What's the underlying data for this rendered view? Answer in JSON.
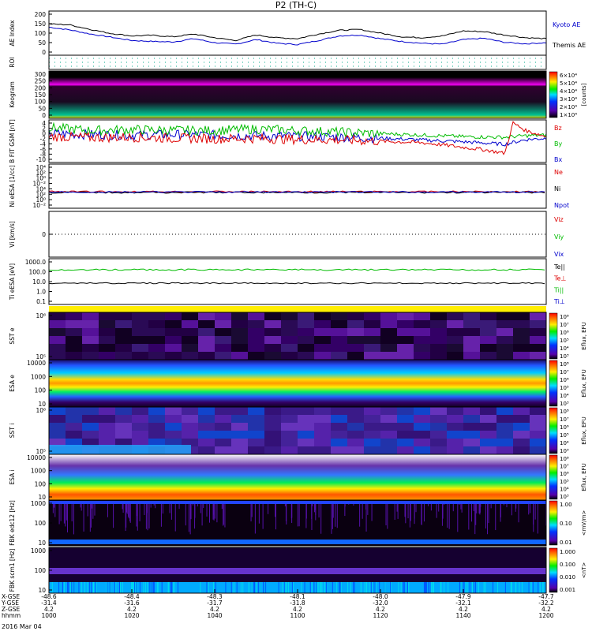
{
  "title": "P2 (TH-C)",
  "date": "2016 Mar 04",
  "chart_data": [
    {
      "type": "line",
      "panel": "ae",
      "ylabel": "AE Index",
      "yticks": [
        "200",
        "150",
        "100",
        "50",
        "0"
      ],
      "ylim": [
        -20,
        220
      ],
      "series": [
        {
          "name": "Kyoto AE",
          "color": "#0000cc",
          "t": [
            1000,
            1005,
            1010,
            1015,
            1020,
            1025,
            1030,
            1035,
            1040,
            1045,
            1050,
            1055,
            1100,
            1105,
            1110,
            1115,
            1120,
            1125,
            1130,
            1135,
            1140,
            1145,
            1150,
            1155,
            1200
          ],
          "values": [
            132,
            118,
            95,
            78,
            60,
            55,
            52,
            70,
            48,
            40,
            65,
            45,
            38,
            60,
            85,
            90,
            70,
            55,
            45,
            40,
            65,
            72,
            50,
            42,
            48
          ]
        },
        {
          "name": "Themis AE",
          "color": "#000000",
          "t": [
            1000,
            1005,
            1010,
            1015,
            1020,
            1025,
            1030,
            1035,
            1040,
            1045,
            1050,
            1055,
            1100,
            1105,
            1110,
            1115,
            1120,
            1125,
            1130,
            1135,
            1140,
            1145,
            1150,
            1155,
            1200
          ],
          "values": [
            150,
            145,
            120,
            98,
            85,
            88,
            80,
            95,
            75,
            60,
            90,
            75,
            70,
            95,
            115,
            120,
            100,
            80,
            75,
            85,
            112,
            108,
            90,
            75,
            70
          ]
        }
      ]
    },
    {
      "type": "heatmap",
      "panel": "roi",
      "ylabel": "ROI"
    },
    {
      "type": "heatmap",
      "panel": "keogram",
      "ylabel": "Keogram",
      "yticks": [
        "300",
        "250",
        "200",
        "150",
        "100",
        "50",
        "0"
      ],
      "ylim": [
        0,
        300
      ],
      "colorbar": {
        "label": "[counts]",
        "ticks": [
          "6×10⁴",
          "5×10⁴",
          "4×10⁴",
          "3×10⁴",
          "2×10⁴",
          "1×10⁴"
        ]
      }
    },
    {
      "type": "line",
      "panel": "bfield",
      "ylabel": "B FIT GSM [nT]",
      "yticks": [
        "4",
        "2",
        "0",
        "-2",
        "-4",
        "-6",
        "-8",
        "-10"
      ],
      "ylim": [
        -10,
        4
      ],
      "series": [
        {
          "name": "Bz",
          "color": "#dd0000",
          "t": [
            1000,
            1010,
            1020,
            1030,
            1040,
            1050,
            1100,
            1110,
            1120,
            1130,
            1135,
            1140,
            1145,
            1150,
            1152,
            1155,
            1200
          ],
          "values": [
            -1.5,
            -1.8,
            -1.7,
            -2.0,
            -2.2,
            -2.1,
            -2.4,
            -2.6,
            -3.0,
            -3.5,
            -4.2,
            -5.0,
            -5.8,
            -7.0,
            3.0,
            0.5,
            -1.5
          ]
        },
        {
          "name": "By",
          "color": "#00bb00",
          "t": [
            1000,
            1010,
            1020,
            1030,
            1040,
            1050,
            1100,
            1110,
            1120,
            1130,
            1140,
            1150,
            1155,
            1200
          ],
          "values": [
            1.5,
            0.5,
            0.8,
            0.6,
            0.5,
            1.0,
            0.5,
            0.0,
            -0.5,
            -1.0,
            -1.5,
            -1.7,
            -1.2,
            -1.0
          ]
        },
        {
          "name": "Bx",
          "color": "#0000cc",
          "t": [
            1000,
            1010,
            1020,
            1030,
            1040,
            1050,
            1100,
            1110,
            1120,
            1130,
            1140,
            1150,
            1155,
            1200
          ],
          "values": [
            -0.5,
            -0.8,
            -1.0,
            -0.8,
            -1.0,
            -1.2,
            -1.4,
            -1.6,
            -2.0,
            -2.6,
            -3.2,
            -4.0,
            -2.5,
            -2.0
          ]
        }
      ]
    },
    {
      "type": "line",
      "panel": "density",
      "ylabel": "Ni eESA [1/cc]",
      "yticks": [
        "10⁴",
        "10²",
        "10⁰",
        "10⁻²",
        "10⁴",
        "10²",
        "10⁰",
        "10⁻²"
      ],
      "series": [
        {
          "name": "Ne",
          "color": "#dd0000"
        },
        {
          "name": "Ni",
          "color": "#000000"
        },
        {
          "name": "Npot",
          "color": "#0000cc"
        }
      ]
    },
    {
      "type": "line",
      "panel": "velocity",
      "ylabel": "Vi [km/s]",
      "yticks": [
        "0"
      ],
      "series": [
        {
          "name": "Viz",
          "color": "#dd0000"
        },
        {
          "name": "Viy",
          "color": "#00bb00"
        },
        {
          "name": "Vix",
          "color": "#0000cc"
        }
      ]
    },
    {
      "type": "line",
      "panel": "temperature",
      "ylabel": "Ti eESA [eV]",
      "yticks": [
        "1000.0",
        "100.0",
        "10.0",
        "1.0",
        "0.1"
      ],
      "series": [
        {
          "name": "Te||",
          "color": "#000000"
        },
        {
          "name": "Te⊥",
          "color": "#dd0000"
        },
        {
          "name": "Ti||",
          "color": "#00bb00",
          "values": [
            400,
            420,
            390,
            410,
            400,
            430,
            410,
            400
          ]
        },
        {
          "name": "Ti⊥",
          "color": "#0000cc",
          "values": [
            10,
            10,
            11,
            10,
            10,
            11,
            10,
            10
          ]
        }
      ]
    },
    {
      "type": "heatmap",
      "panel": "sst_e",
      "ylabel": "SST e",
      "yticks": [
        "10⁶",
        "10⁵"
      ],
      "colorbar": {
        "label": "Eflux, EFU",
        "ticks": [
          "10⁸",
          "10⁷",
          "10⁶",
          "10⁵",
          "10⁴",
          "10³"
        ]
      }
    },
    {
      "type": "heatmap",
      "panel": "esa_e",
      "ylabel": "ESA e",
      "yticks": [
        "10000",
        "1000",
        "100",
        "10"
      ],
      "colorbar": {
        "label": "Eflux, EFU",
        "ticks": [
          "10⁸",
          "10⁷",
          "10⁶",
          "10⁵",
          "10⁴",
          "10³"
        ]
      }
    },
    {
      "type": "heatmap",
      "panel": "sst_i",
      "ylabel": "SST i",
      "yticks": [
        "10⁶",
        "10⁵"
      ],
      "colorbar": {
        "label": "Eflux, EFU",
        "ticks": [
          "10⁸",
          "10⁷",
          "10⁶",
          "10⁵",
          "10⁴",
          "10³"
        ]
      }
    },
    {
      "type": "heatmap",
      "panel": "esa_i",
      "ylabel": "ESA i",
      "yticks": [
        "10000",
        "1000",
        "100",
        "10"
      ],
      "colorbar": {
        "label": "Eflux, EFU",
        "ticks": [
          "10⁸",
          "10⁷",
          "10⁶",
          "10⁵",
          "10⁴",
          "10³"
        ]
      }
    },
    {
      "type": "heatmap",
      "panel": "fbk_e",
      "ylabel": "FBK edc12 [Hz]",
      "yticks": [
        "1000",
        "100",
        "10"
      ],
      "colorbar": {
        "label": "<mV/m>",
        "ticks": [
          "1.00",
          "0.10",
          "0.01"
        ]
      }
    },
    {
      "type": "heatmap",
      "panel": "fbk_b",
      "ylabel": "FBK scm1 [Hz]",
      "yticks": [
        "1000",
        "100",
        "10"
      ],
      "colorbar": {
        "label": "<nT>",
        "ticks": [
          "1.000",
          "0.100",
          "0.010",
          "0.001"
        ]
      }
    }
  ],
  "xaxis": {
    "rows": [
      "X-GSE",
      "Y-GSE",
      "Z-GSE",
      "hhmm"
    ],
    "ticks": [
      {
        "x_gse": "-48.6",
        "y_gse": "-31.4",
        "z_gse": "4.2",
        "hhmm": "1000"
      },
      {
        "x_gse": "-48.4",
        "y_gse": "-31.6",
        "z_gse": "4.2",
        "hhmm": "1020"
      },
      {
        "x_gse": "-48.3",
        "y_gse": "-31.7",
        "z_gse": "4.2",
        "hhmm": "1040"
      },
      {
        "x_gse": "-48.1",
        "y_gse": "-31.8",
        "z_gse": "4.2",
        "hhmm": "1100"
      },
      {
        "x_gse": "-48.0",
        "y_gse": "-32.0",
        "z_gse": "4.2",
        "hhmm": "1120"
      },
      {
        "x_gse": "-47.9",
        "y_gse": "-32.1",
        "z_gse": "4.2",
        "hhmm": "1140"
      },
      {
        "x_gse": "-47.7",
        "y_gse": "-32.2",
        "z_gse": "4.2",
        "hhmm": "1200"
      }
    ]
  },
  "colors": {
    "magenta_band": "#ff00ff",
    "yellow_band": "#ffee00"
  }
}
